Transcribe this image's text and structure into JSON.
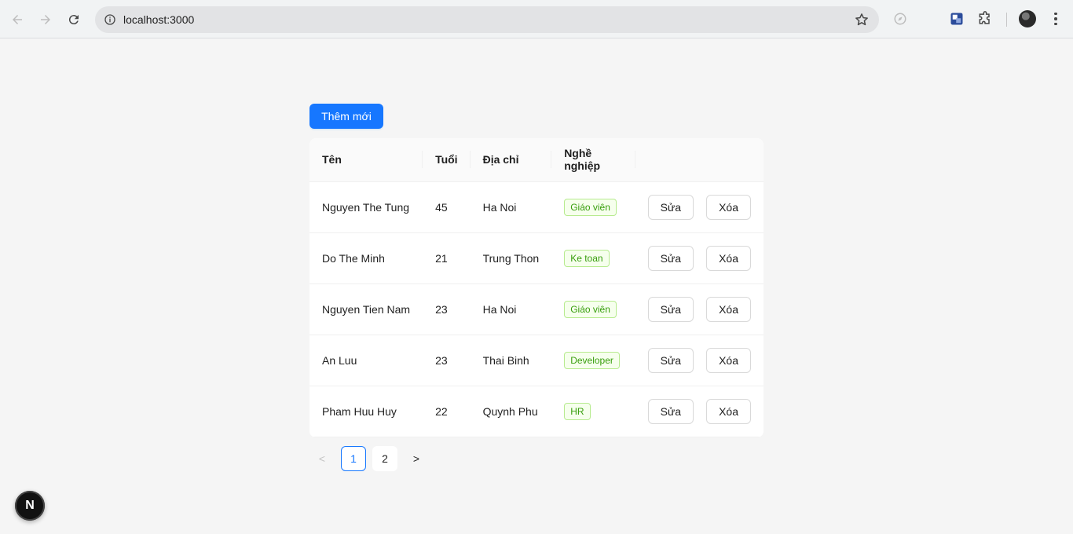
{
  "browser": {
    "url": "localhost:3000"
  },
  "page": {
    "add_button_label": "Thêm mới",
    "table": {
      "headers": [
        "Tên",
        "Tuổi",
        "Địa chỉ",
        "Nghề nghiệp",
        ""
      ],
      "rows": [
        {
          "name": "Nguyen The Tung",
          "age": "45",
          "address": "Ha Noi",
          "job": "Giáo viên"
        },
        {
          "name": "Do The Minh",
          "age": "21",
          "address": "Trung Thon",
          "job": "Ke toan"
        },
        {
          "name": "Nguyen Tien Nam",
          "age": "23",
          "address": "Ha Noi",
          "job": "Giáo viên"
        },
        {
          "name": "An Luu",
          "age": "23",
          "address": "Thai Binh",
          "job": "Developer"
        },
        {
          "name": "Pham Huu Huy",
          "age": "22",
          "address": "Quynh Phu",
          "job": "HR"
        }
      ],
      "edit_label": "Sửa",
      "delete_label": "Xóa"
    },
    "pagination": {
      "pages": [
        "1",
        "2"
      ],
      "current": "1",
      "prev_symbol": "<",
      "next_symbol": ">"
    },
    "dev_badge": "N"
  },
  "colors": {
    "primary": "#1677ff",
    "tag_text": "#389e0d",
    "tag_bg": "#f6ffed",
    "tag_border": "#b7eb8f"
  }
}
